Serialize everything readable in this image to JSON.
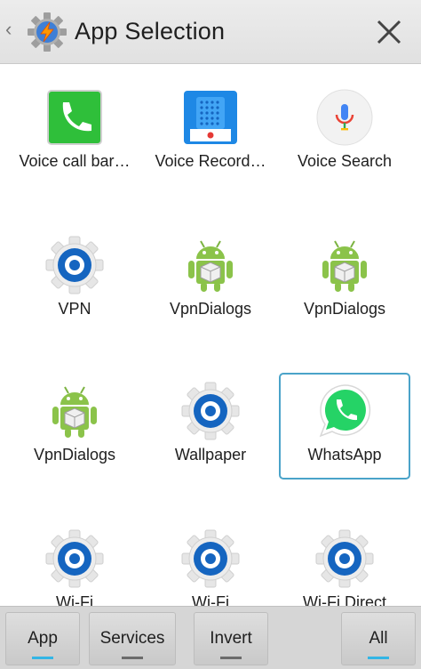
{
  "header": {
    "back_glyph": "‹",
    "title": "App Selection",
    "logo_icon": "tasker-gear-lightning-icon",
    "close_icon": "close-icon"
  },
  "apps": [
    {
      "label": "Voice call bar…",
      "icon": "phone-icon"
    },
    {
      "label": "Voice Record…",
      "icon": "voice-recorder-icon"
    },
    {
      "label": "Voice Search",
      "icon": "microphone-icon"
    },
    {
      "label": "VPN",
      "icon": "system-gear-icon"
    },
    {
      "label": "VpnDialogs",
      "icon": "android-package-icon"
    },
    {
      "label": "VpnDialogs",
      "icon": "android-package-icon"
    },
    {
      "label": "VpnDialogs",
      "icon": "android-package-icon"
    },
    {
      "label": "Wallpaper",
      "icon": "system-gear-icon"
    },
    {
      "label": "WhatsApp",
      "icon": "whatsapp-icon",
      "selected": true
    },
    {
      "label": "Wi-Fi",
      "icon": "system-gear-icon"
    },
    {
      "label": "Wi-Fi",
      "icon": "system-gear-icon"
    },
    {
      "label": "Wi-Fi Direct",
      "icon": "system-gear-icon"
    }
  ],
  "bottom_tabs": [
    {
      "label": "App",
      "active": true
    },
    {
      "label": "Services",
      "active": false
    },
    {
      "label": "Invert",
      "active": false
    },
    {
      "label": "All",
      "active": true
    }
  ],
  "colors": {
    "accent": "#33b5e5",
    "selection_border": "#4aa3c9",
    "gear_blue": "#1565c0",
    "android_green": "#8bc34a",
    "whatsapp_green": "#25d366"
  }
}
